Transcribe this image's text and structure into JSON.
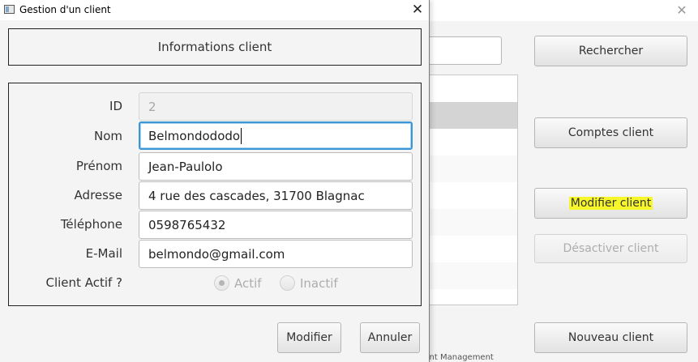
{
  "background": {
    "buttons": {
      "search": "Rechercher",
      "accounts": "Comptes client",
      "modify": "Modifier client",
      "deactivate": "Désactiver client",
      "new": "Nouveau client"
    },
    "bottom_text": "...nt Management"
  },
  "dialog": {
    "title": "Gestion d'un client",
    "header": "Informations client",
    "fields": {
      "id": {
        "label": "ID",
        "value": "2"
      },
      "nom": {
        "label": "Nom",
        "value": "Belmondododo"
      },
      "prenom": {
        "label": "Prénom",
        "value": "Jean-Paulolo"
      },
      "adresse": {
        "label": "Adresse",
        "value": "4 rue des cascades, 31700 Blagnac"
      },
      "tel": {
        "label": "Téléphone",
        "value": "0598765432"
      },
      "email": {
        "label": "E-Mail",
        "value": "belmondo@gmail.com"
      }
    },
    "actif": {
      "label": "Client Actif ?",
      "options": [
        "Actif",
        "Inactif"
      ],
      "selected": "Actif"
    },
    "buttons": {
      "modify": "Modifier",
      "cancel": "Annuler"
    }
  },
  "colors": {
    "focus": "#3b96d6",
    "highlight": "#f6f629"
  }
}
